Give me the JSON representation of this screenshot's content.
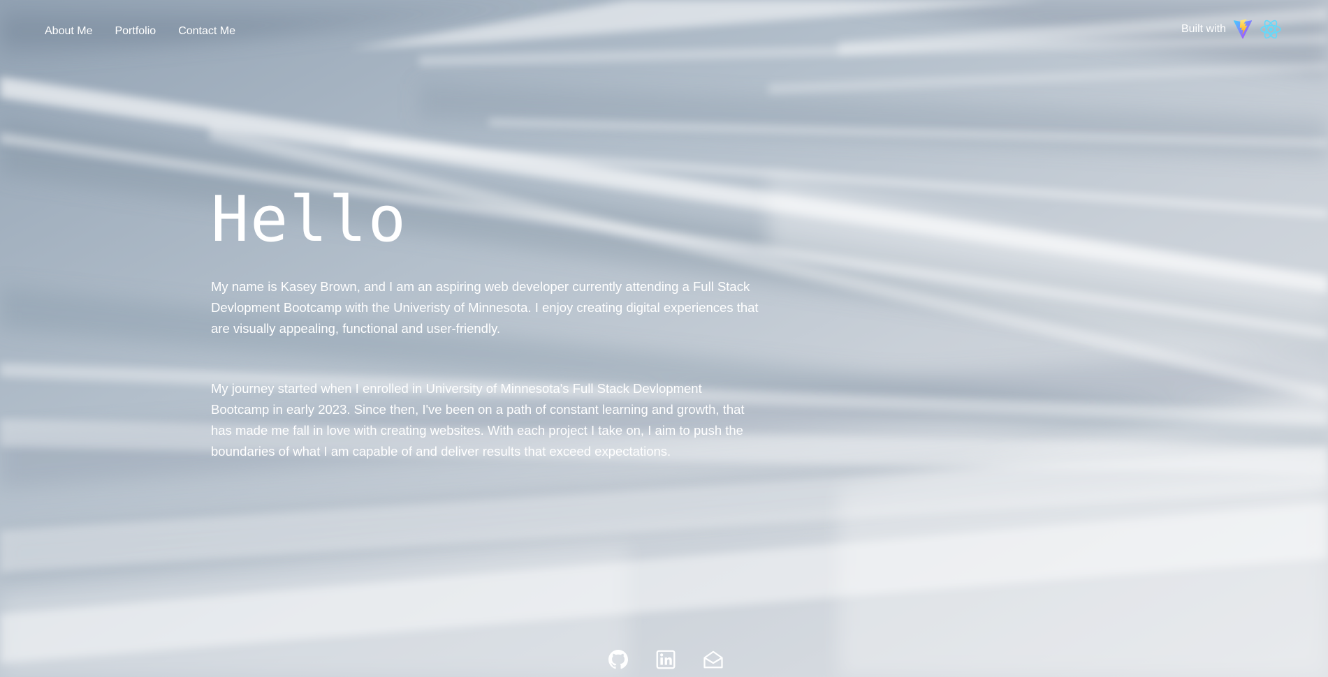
{
  "nav": {
    "items": [
      {
        "label": "About Me"
      },
      {
        "label": "Portfolio"
      },
      {
        "label": "Contact Me"
      }
    ]
  },
  "built_with": {
    "label": "Built with",
    "icons": [
      "vite-icon",
      "react-icon"
    ]
  },
  "hero": {
    "title": "Hello",
    "paragraph_1": "My name is Kasey Brown, and I am an aspiring web developer currently attending a Full Stack Devlopment Bootcamp with the Univeristy of Minnesota. I enjoy creating digital experiences that are visually appealing, functional and user-friendly.",
    "paragraph_2": "My journey started when I enrolled in University of Minnesota's Full Stack Devlopment Bootcamp in early 2023. Since then, I've been on a path of constant learning and growth, that has made me fall in love with creating websites. With each project I take on, I aim to push the boundaries of what I am capable of and deliver results that exceed expectations."
  },
  "socials": {
    "icons": [
      "github-icon",
      "linkedin-icon",
      "email-icon"
    ]
  },
  "colors": {
    "text": "#ffffff",
    "background": "#a9b6c4",
    "vite_purple": "#9c5cff",
    "vite_yellow": "#ffd62e",
    "react_cyan": "#61dafb"
  }
}
